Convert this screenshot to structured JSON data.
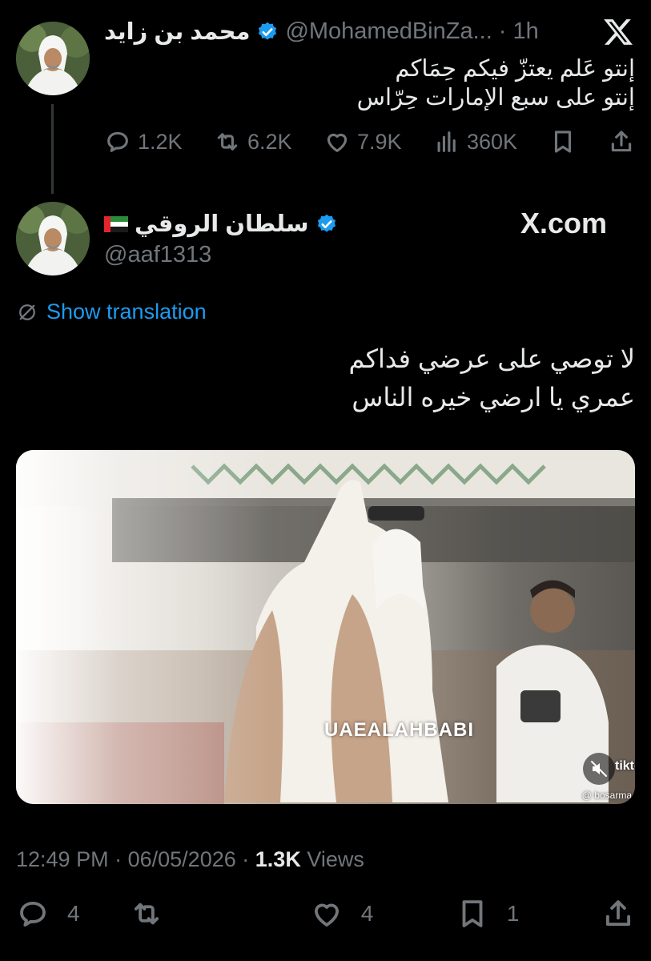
{
  "header": {
    "x_logo": "𝕏"
  },
  "parent_tweet": {
    "name": "محمد بن زايد",
    "handle": "@MohamedBinZa...",
    "time": "· 1h",
    "lines": [
      "إنتو عَلم يعتزّ فيكم حِمَاكم",
      "إنتو على سبع الإمارات حِرّاس"
    ],
    "actions": {
      "replies": "1.2K",
      "retweets": "6.2K",
      "likes": "7.9K",
      "views": "360K"
    }
  },
  "main_tweet": {
    "name": "سلطان الروقي",
    "flag_icon": "uae-flag-icon",
    "handle": "@aaf1313",
    "xcom_label": "X.com",
    "translation_label": "Show translation",
    "lines": [
      "لا توصي على عرضي فداكم",
      "عمري يا ارضي خيره الناس"
    ],
    "video": {
      "watermark": "UAEALAHBABI",
      "tiktok_label": "tiktok",
      "tiktok_user": "@ bosarma"
    },
    "meta": {
      "time": "12:49 PM",
      "date": "06/05/2026",
      "views_count": "1.3K",
      "views_label": "Views"
    },
    "actions": {
      "replies": "4",
      "likes": "4",
      "bookmarks": "1"
    }
  },
  "colors": {
    "background": "#000000",
    "text": "#e7e9ea",
    "muted": "#71767b",
    "link": "#1d9bf0",
    "verified": "#1d9bf0"
  }
}
